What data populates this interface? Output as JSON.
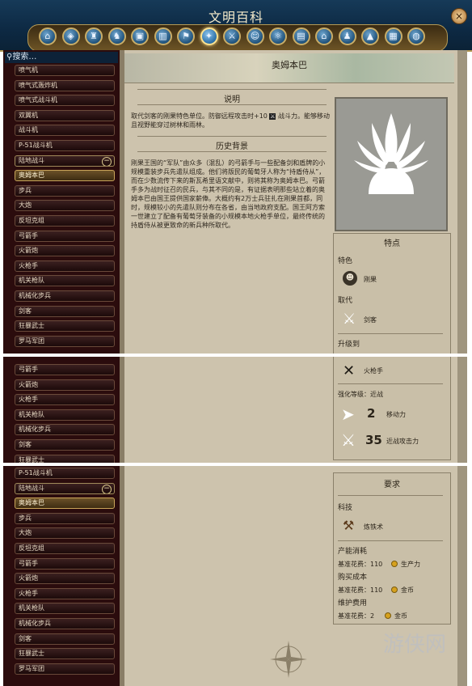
{
  "window": {
    "title": "文明百科",
    "close_icon": "×"
  },
  "category_bar": {
    "icons": [
      "home-icon",
      "map-icon",
      "cup-icon",
      "helmet-icon",
      "crate-icon",
      "city-icon",
      "guard-icon",
      "unit-icon",
      "swords-icon",
      "leader-icon",
      "atom-icon",
      "book-icon",
      "building-icon",
      "people-icon",
      "mountain-icon",
      "scroll-icon",
      "globe-icon"
    ],
    "active_index": 7
  },
  "sidebar": {
    "search_label": "搜索…",
    "panel1": [
      "喷气机",
      "喷气式轰炸机",
      "喷气式战斗机",
      "双翼机",
      "战斗机",
      "P-51战斗机",
      "陆地战斗",
      "奥姆本巴",
      "步兵",
      "大炮",
      "反坦克组",
      "弓箭手",
      "火箭炮",
      "火枪手",
      "机关枪队",
      "机械化步兵",
      "剑客",
      "狂暴武士",
      "罗马军团"
    ],
    "panel2": [
      "弓箭手",
      "火箭炮",
      "火枪手",
      "机关枪队",
      "机械化步兵",
      "剑客",
      "狂暴武士"
    ],
    "panel3": [
      "P-51战斗机",
      "陆地战斗",
      "奥姆本巴",
      "步兵",
      "大炮",
      "反坦克组",
      "弓箭手",
      "火箭炮",
      "火枪手",
      "机关枪队",
      "机械化步兵",
      "剑客",
      "狂暴武士",
      "罗马军团"
    ]
  },
  "main": {
    "unit_name": "奥姆本巴",
    "description_title": "说明",
    "description": "取代剑客的刚果特色单位。防御远程攻击时+10",
    "description_icon_text": "战斗力。能够移动且视野能穿过树林和雨林。",
    "history_title": "历史背景",
    "history": "刚果王国的“军队”由众多（混乱）的弓箭手与一些配备剑和盾牌的小规模重装步兵先遣队组成。他们将版民的葡萄牙人称为“持盾侍从”，而在少数流传下来的斯瓦希里语文献中，则将其称为奥姆本巴。弓箭手多为战时征召的民兵，与其不同的是，有证据表明那些站立着的奥姆本巴由国王提供国家薪俸。大概约有2万士兵驻扎在刚果首都，同时，规模较小的先遣队则分布在各省，由当地政府支配。国王阿方索一世建立了配备有葡萄牙装备的小规模本地火枪手单位，最终传统的持盾侍从被更致命的新兵种所取代。"
  },
  "traits": {
    "title": "特点",
    "special_label": "特色",
    "civ_name": "刚果",
    "replaces_label": "取代",
    "replaces_unit": "剑客",
    "upgrade_label": "升级到",
    "upgrade_unit": "火枪手",
    "strength_label": "强化等级：近战",
    "movement_value": "2",
    "movement_label": "移动力",
    "melee_value": "35",
    "melee_label": "近战攻击力"
  },
  "requirements": {
    "title": "要求",
    "tech_label": "科技",
    "tech_name": "炼铁术",
    "production_label": "产能消耗",
    "production_cost": "基准花费：110",
    "production_unit": "生产力",
    "purchase_label": "购买成本",
    "purchase_cost": "基准花费：110",
    "purchase_unit": "金币",
    "maintenance_label": "维护费用",
    "maintenance_cost": "基准花费：2",
    "maintenance_unit": "金币"
  },
  "watermark": "游侠网"
}
